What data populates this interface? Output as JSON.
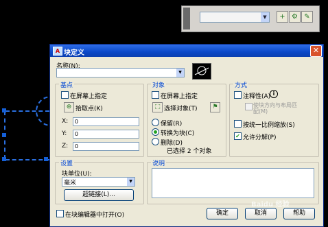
{
  "toolbar": {
    "combo_value": "",
    "btn1_icon": "add-icon",
    "btn2_icon": "settings-icon",
    "btn3_icon": "edit-icon"
  },
  "dialog": {
    "title": "块定义",
    "close_glyph": "✕",
    "name_label": "名称(N):",
    "name_value": "",
    "base_point": {
      "title": "基点",
      "specify_on_screen": "在屏幕上指定",
      "pick_point": "拾取点(K)",
      "x_label": "X:",
      "x_value": "0",
      "y_label": "Y:",
      "y_value": "0",
      "z_label": "Z:",
      "z_value": "0"
    },
    "objects": {
      "title": "对象",
      "specify_on_screen": "在屏幕上指定",
      "select_objects": "选择对象(T)",
      "retain": "保留(R)",
      "convert_to_block": "转换为块(C)",
      "delete": "删除(D)",
      "selected_count": "已选择 2 个对象"
    },
    "behavior": {
      "title": "方式",
      "annotative": "注释性(A)",
      "match_orientation": "使块方向与布局匹配(M)",
      "scale_uniformly": "按统一比例缩放(S)",
      "allow_exploding": "允许分解(P)",
      "allow_exploding_checked": "✔"
    },
    "settings": {
      "title": "设置",
      "block_unit_label": "块单位(U):",
      "block_unit_value": "毫米",
      "hyperlink": "超链接(L)..."
    },
    "description": {
      "title": "说明"
    },
    "open_in_editor": "在块编辑器中打开(O)",
    "ok": "确定",
    "cancel": "取消",
    "help": "帮助"
  },
  "watermark": "Baidu 经验"
}
